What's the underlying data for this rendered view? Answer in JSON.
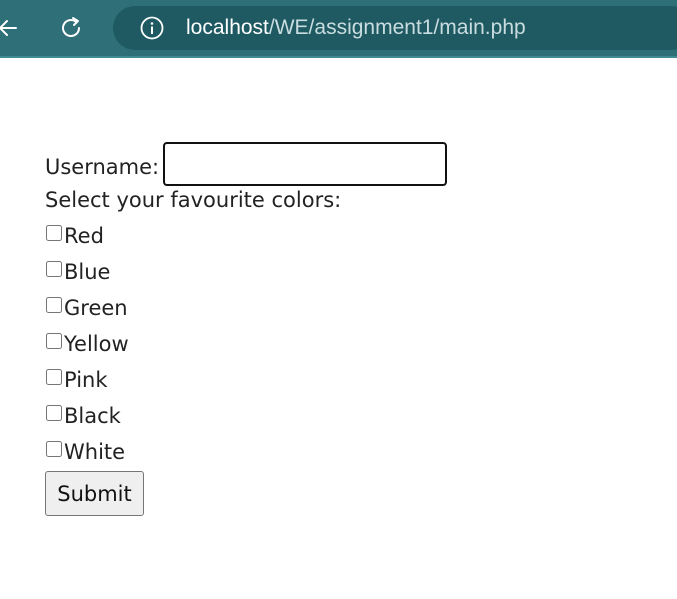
{
  "browser": {
    "url_host": "localhost",
    "url_path": "/WE/assignment1/main.php",
    "icons": [
      "back-arrow-icon",
      "reload-icon",
      "info-icon"
    ],
    "colors": {
      "toolbar": "#2e6f78",
      "address_bar": "#1f5a63"
    }
  },
  "form": {
    "username_label": "Username:",
    "username_value": "",
    "colors_prompt": "Select your favourite colors:",
    "color_options": [
      {
        "label": "Red",
        "checked": false
      },
      {
        "label": "Blue",
        "checked": false
      },
      {
        "label": "Green",
        "checked": false
      },
      {
        "label": "Yellow",
        "checked": false
      },
      {
        "label": "Pink",
        "checked": false
      },
      {
        "label": "Black",
        "checked": false
      },
      {
        "label": "White",
        "checked": false
      }
    ],
    "submit_label": "Submit"
  }
}
